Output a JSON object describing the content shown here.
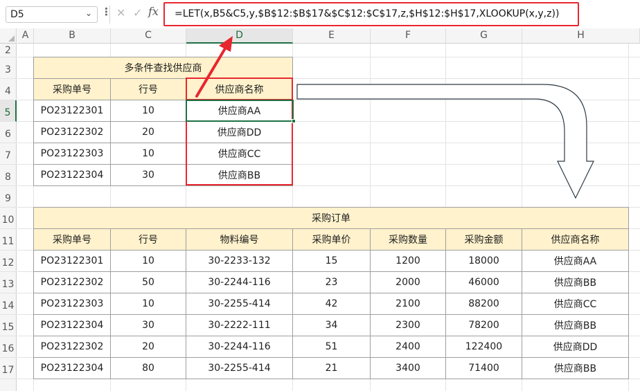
{
  "formula_bar": {
    "name_box": "D5",
    "dropdown_icon": "chevron-down-icon",
    "more_icon": "vertical-dots-icon",
    "cancel_icon": "close-icon",
    "enter_icon": "check-icon",
    "fx_label": "fx",
    "formula": "=LET(x,B5&C5,y,$B$12:$B$17&$C$12:$C$17,z,$H$12:$H$17,XLOOKUP(x,y,z))"
  },
  "columns": [
    "A",
    "B",
    "C",
    "D",
    "E",
    "F",
    "G",
    "H"
  ],
  "rows": [
    "2",
    "3",
    "4",
    "5",
    "6",
    "7",
    "8",
    "9",
    "10",
    "11",
    "12",
    "13",
    "14",
    "15",
    "16",
    "17"
  ],
  "lookup_table": {
    "title": "多条件查找供应商",
    "headers": [
      "采购单号",
      "行号",
      "供应商名称"
    ],
    "rows": [
      [
        "PO23122301",
        "10",
        "供应商AA"
      ],
      [
        "PO23122302",
        "20",
        "供应商DD"
      ],
      [
        "PO23122303",
        "10",
        "供应商CC"
      ],
      [
        "PO23122304",
        "30",
        "供应商BB"
      ]
    ]
  },
  "order_table": {
    "title": "采购订单",
    "headers": [
      "采购单号",
      "行号",
      "物料编号",
      "采购单价",
      "采购数量",
      "采购金额",
      "供应商名称"
    ],
    "rows": [
      [
        "PO23122301",
        "10",
        "30-2233-132",
        "15",
        "1200",
        "18000",
        "供应商AA"
      ],
      [
        "PO23122302",
        "50",
        "30-2244-116",
        "23",
        "2000",
        "46000",
        "供应商BB"
      ],
      [
        "PO23122303",
        "10",
        "30-2255-414",
        "42",
        "2100",
        "88200",
        "供应商CC"
      ],
      [
        "PO23122304",
        "30",
        "30-2222-111",
        "34",
        "2300",
        "78200",
        "供应商BB"
      ],
      [
        "PO23122302",
        "20",
        "30-2244-116",
        "51",
        "2400",
        "122400",
        "供应商DD"
      ],
      [
        "PO23122304",
        "80",
        "30-2255-414",
        "21",
        "3400",
        "71400",
        "供应商BB"
      ]
    ]
  },
  "colors": {
    "accent_red": "#e8262e",
    "selection_green": "#1e7145",
    "header_fill": "#fff2cc"
  }
}
